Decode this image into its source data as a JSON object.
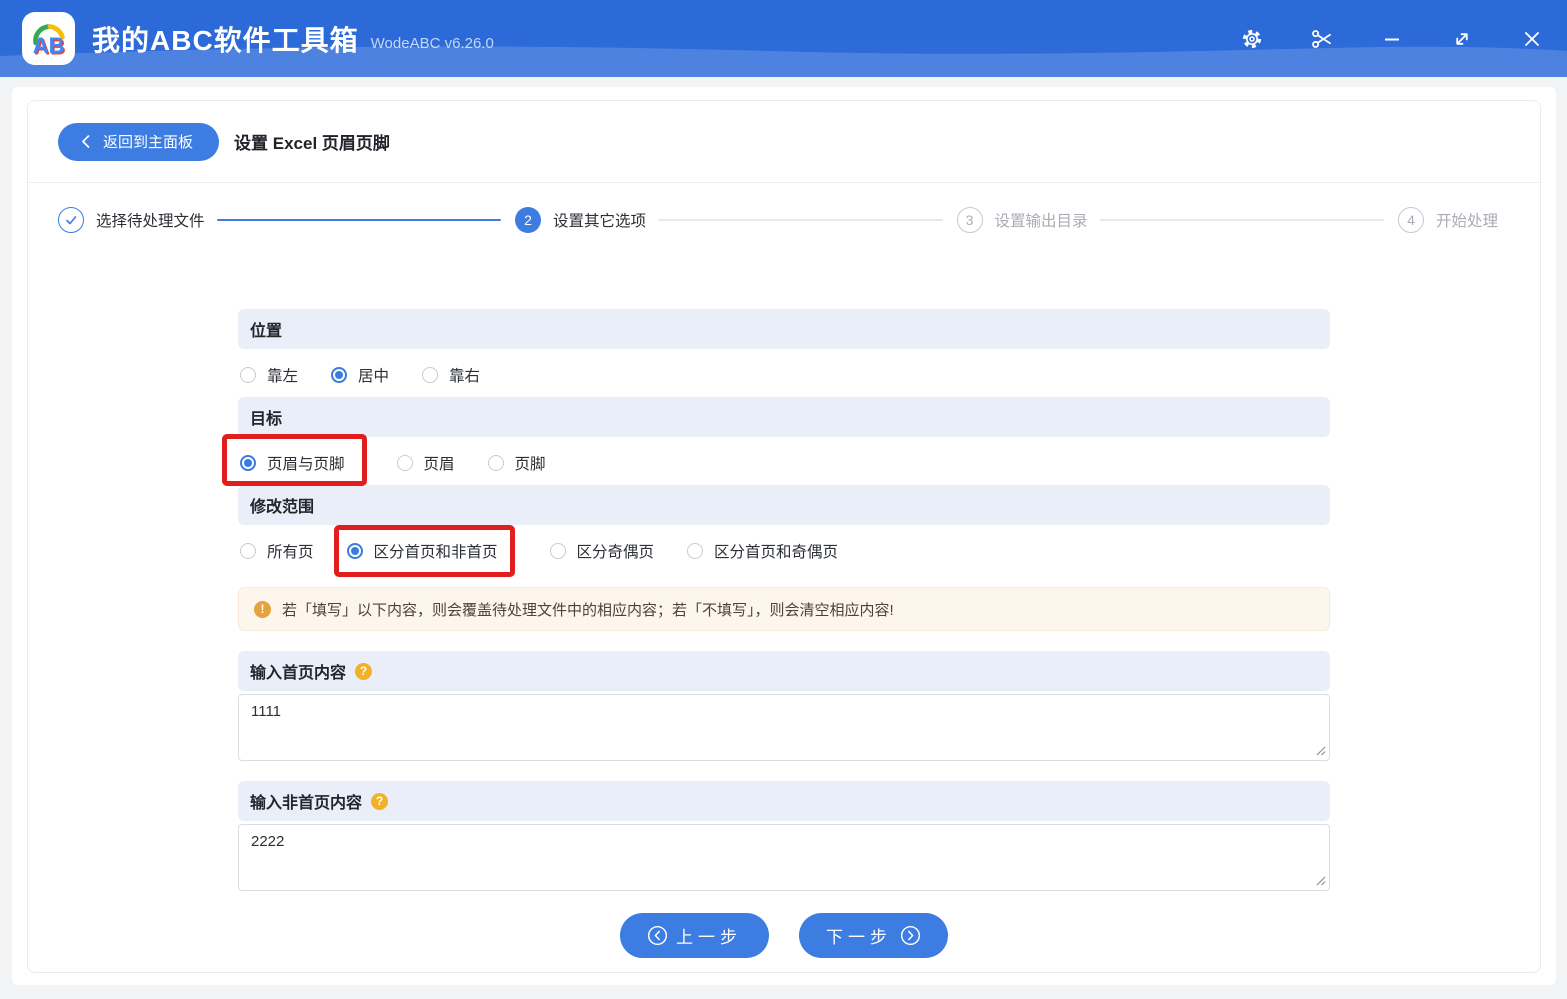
{
  "titlebar": {
    "logo_text": "AB",
    "app_title": "我的ABC软件工具箱",
    "version": "WodeABC v6.26.0",
    "window_icons": [
      "settings-icon",
      "scissors-icon",
      "minimize-icon",
      "maximize-icon",
      "close-icon"
    ]
  },
  "header": {
    "back_label": "返回到主面板",
    "page_title": "设置 Excel 页眉页脚"
  },
  "stepper": {
    "steps": [
      {
        "num": "1",
        "label": "选择待处理文件",
        "state": "done"
      },
      {
        "num": "2",
        "label": "设置其它选项",
        "state": "active"
      },
      {
        "num": "3",
        "label": "设置输出目录",
        "state": "pending"
      },
      {
        "num": "4",
        "label": "开始处理",
        "state": "pending"
      }
    ]
  },
  "sections": {
    "position": {
      "title": "位置",
      "options": [
        {
          "label": "靠左",
          "selected": false
        },
        {
          "label": "居中",
          "selected": true
        },
        {
          "label": "靠右",
          "selected": false
        }
      ]
    },
    "target": {
      "title": "目标",
      "options": [
        {
          "label": "页眉与页脚",
          "selected": true,
          "annotated": true
        },
        {
          "label": "页眉",
          "selected": false
        },
        {
          "label": "页脚",
          "selected": false
        }
      ]
    },
    "scope": {
      "title": "修改范围",
      "options": [
        {
          "label": "所有页",
          "selected": false
        },
        {
          "label": "区分首页和非首页",
          "selected": true,
          "annotated": true
        },
        {
          "label": "区分奇偶页",
          "selected": false
        },
        {
          "label": "区分首页和奇偶页",
          "selected": false
        }
      ]
    }
  },
  "notice": {
    "text": "若「填写」以下内容，则会覆盖待处理文件中的相应内容；若「不填写」，则会清空相应内容!"
  },
  "inputs": {
    "first_page": {
      "title": "输入首页内容",
      "value": "1111"
    },
    "other_pages": {
      "title": "输入非首页内容",
      "value": "2222"
    }
  },
  "footer": {
    "prev_label": "上一步",
    "next_label": "下一步"
  },
  "colors": {
    "titlebar_blue": "#2b69d8",
    "accent_blue": "#3d7ce0",
    "radio_blue": "#3a7be2",
    "section_header_bg": "#e9eef9",
    "notice_bg": "#fdf6ec",
    "notice_icon": "#e6a23c",
    "help_icon": "#f2b127",
    "annotation_red": "#e11d1d"
  }
}
